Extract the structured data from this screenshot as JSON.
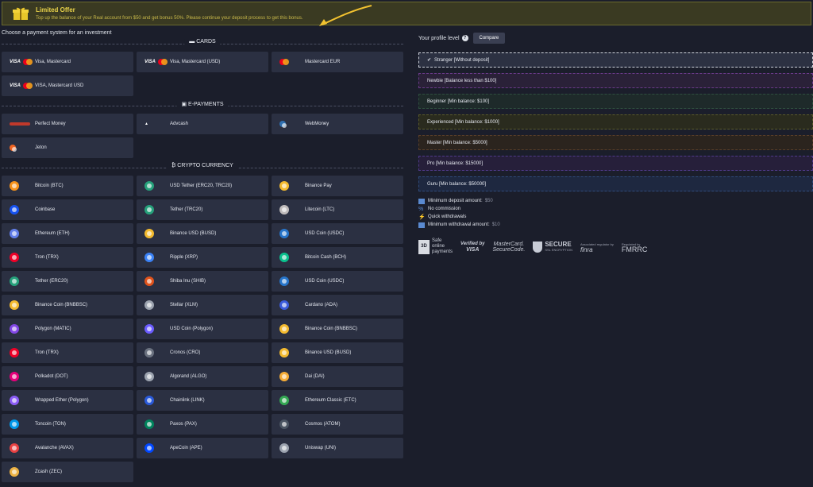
{
  "banner": {
    "title": "Limited Offer",
    "description": "Top up the balance of your Real account from $50 and get bonus 50%. Please continue your deposit process to get this bonus.",
    "accent": "#e8d24a"
  },
  "left": {
    "heading": "Choose a payment system for an investment",
    "sections": [
      {
        "label": "CARDS",
        "items": [
          {
            "name": "Visa, Mastercard",
            "icon": "visa-mastercard-icon"
          },
          {
            "name": "Visa, Mastercard (USD)",
            "icon": "visa-mastercard-icon"
          },
          {
            "name": "Mastercard EUR",
            "icon": "mastercard-icon"
          },
          {
            "name": "VISA, Mastercard USD",
            "icon": "visa-mastercard-icon"
          }
        ]
      },
      {
        "label": "E-PAYMENTS",
        "items": [
          {
            "name": "Perfect Money",
            "icon": "perfect-money-icon"
          },
          {
            "name": "Advcash",
            "icon": "advcash-icon"
          },
          {
            "name": "WebMoney",
            "icon": "webmoney-icon"
          },
          {
            "name": "Jeton",
            "icon": "jeton-icon"
          }
        ]
      },
      {
        "label": "CRYPTO CURRENCY",
        "items": [
          {
            "name": "Bitcoin (BTC)",
            "color": "#f7931a"
          },
          {
            "name": "USD Tether (ERC20, TRC20)",
            "color": "#26a17b"
          },
          {
            "name": "Binance Pay",
            "color": "#f3ba2f"
          },
          {
            "name": "Coinbase",
            "color": "#1652f0"
          },
          {
            "name": "Tether (TRC20)",
            "color": "#26a17b"
          },
          {
            "name": "Litecoin (LTC)",
            "color": "#bfbbbb"
          },
          {
            "name": "Ethereum (ETH)",
            "color": "#627eea"
          },
          {
            "name": "Binance USD (BUSD)",
            "color": "#f3ba2f"
          },
          {
            "name": "USD Coin (USDC)",
            "color": "#2775ca"
          },
          {
            "name": "Tron (TRX)",
            "color": "#ef0027"
          },
          {
            "name": "Ripple (XRP)",
            "color": "#3b82f6"
          },
          {
            "name": "Bitcoin Cash (BCH)",
            "color": "#0ac18e"
          },
          {
            "name": "Tether (ERC20)",
            "color": "#26a17b"
          },
          {
            "name": "Shiba Inu (SHIB)",
            "color": "#e0531c"
          },
          {
            "name": "USD Coin (USDC)",
            "color": "#2775ca"
          },
          {
            "name": "Binance Coin (BNBBSC)",
            "color": "#f3ba2f"
          },
          {
            "name": "Stellar (XLM)",
            "color": "#9ca3af"
          },
          {
            "name": "Cardano (ADA)",
            "color": "#3b5bdb"
          },
          {
            "name": "Polygon (MATIC)",
            "color": "#8247e5"
          },
          {
            "name": "USD Coin (Polygon)",
            "color": "#6b5cff"
          },
          {
            "name": "Binance Coin (BNBBSC)",
            "color": "#f3ba2f"
          },
          {
            "name": "Tron (TRX)",
            "color": "#ef0027"
          },
          {
            "name": "Cronos (CRO)",
            "color": "#6b7280"
          },
          {
            "name": "Binance USD (BUSD)",
            "color": "#f3ba2f"
          },
          {
            "name": "Polkadot (DOT)",
            "color": "#e6007a"
          },
          {
            "name": "Algorand (ALGO)",
            "color": "#9ca3af"
          },
          {
            "name": "Dai (DAI)",
            "color": "#f5ac37"
          },
          {
            "name": "Wrapped Ether (Polygon)",
            "color": "#8b5cf6"
          },
          {
            "name": "Chainlink (LINK)",
            "color": "#2a5ada"
          },
          {
            "name": "Ethereum Classic (ETC)",
            "color": "#34a853"
          },
          {
            "name": "Toncoin (TON)",
            "color": "#0098ea"
          },
          {
            "name": "Paxos (PAX)",
            "color": "#00845d"
          },
          {
            "name": "Cosmos (ATOM)",
            "color": "#4b5563"
          },
          {
            "name": "Avalanche (AVAX)",
            "color": "#e84142"
          },
          {
            "name": "ApeCoin (APE)",
            "color": "#0047ff"
          },
          {
            "name": "Uniswap (UNI)",
            "color": "#9ca3af"
          },
          {
            "name": "Zcash (ZEC)",
            "color": "#ecb244"
          }
        ]
      }
    ]
  },
  "right": {
    "profile_label": "Your profile level",
    "compare_label": "Compare",
    "levels": [
      "Stranger [Without deposit]",
      "Newbie [Balance less than $100]",
      "Beginner [Min balance: $100]",
      "Experienced [Min balance: $1000]",
      "Master [Min balance: $5000]",
      "Pro [Min balance: $15000]",
      "Guru [Min balance: $50000]"
    ],
    "features": [
      {
        "label": "Minimum deposit amount:",
        "value": "$50"
      },
      {
        "label": "No commission",
        "value": ""
      },
      {
        "label": "Quick withdrawals",
        "value": ""
      },
      {
        "label": "Minimum withdrawal amount:",
        "value": "$10"
      }
    ],
    "trust": {
      "secure3d_box": "3D",
      "secure3d_text": "Safe online payments",
      "visa_top": "Verified by",
      "visa_bottom": "VISA",
      "mc_top": "MasterCard.",
      "mc_bottom": "SecureCode.",
      "secure_top": "SECURE",
      "secure_bottom": "SSL ENCRYPTION",
      "finra_top": "Associated regulator by",
      "finra": "finra",
      "fmrrc_top": "Regulated by",
      "fmrrc": "FMRRC"
    }
  }
}
